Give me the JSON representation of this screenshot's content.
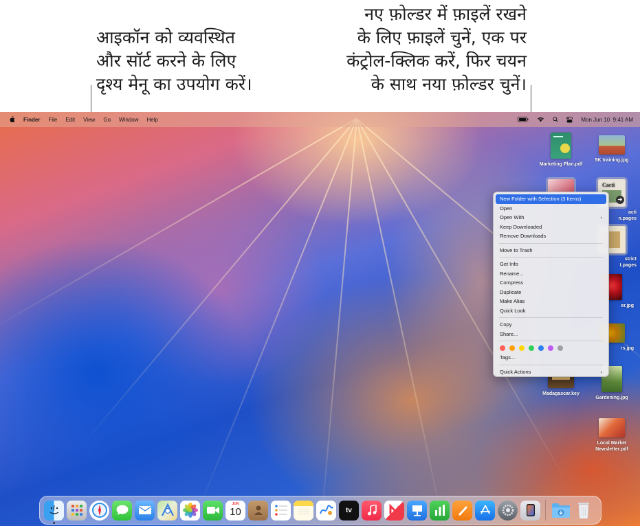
{
  "callouts": {
    "left": [
      "आइकॉन को व्यवस्थित",
      "और सॉर्ट करने के लिए",
      "दृश्य मेनू का उपयोग करें।"
    ],
    "right": [
      "नए फ़ोल्डर में फ़ाइलें रखने",
      "के लिए फ़ाइलें चुनें, एक पर",
      "कंट्रोल-क्लिक करें, फिर चयन",
      "के साथ नया फ़ोल्डर चुनें।"
    ]
  },
  "menubar": {
    "app_name": "Finder",
    "items": [
      "File",
      "Edit",
      "View",
      "Go",
      "Window",
      "Help"
    ],
    "datetime": "Mon Jun 10  9:41 AM"
  },
  "desktop_icons": [
    {
      "label": "Marketing Plan.pdf",
      "icon": "pdf-document"
    },
    {
      "label": "5K training.jpg",
      "icon": "photo-runners"
    },
    {
      "label": "acti",
      "label2": "n.pages",
      "icon": "pages-document-cacti"
    },
    {
      "label": "strict",
      "label2": "t.pages",
      "icon": "pages-document"
    },
    {
      "label": "er.jpg",
      "icon": "photo-flower"
    },
    {
      "label": "rs.jpg",
      "icon": "photo-sunflowers"
    },
    {
      "label": "Madagascar.key",
      "icon": "keynote-document"
    },
    {
      "label": "Gardening.jpg",
      "icon": "photo-garden"
    },
    {
      "label": "Local Market",
      "label2": "Newsletter.pdf",
      "icon": "pdf-newsletter"
    }
  ],
  "context_menu": {
    "group1": [
      "New Folder with Selection (3 Items)",
      "Open",
      "Open With",
      "Keep Downloaded",
      "Remove Downloads"
    ],
    "group2": [
      "Move to Trash"
    ],
    "group3": [
      "Get Info",
      "Rename...",
      "Compress",
      "Duplicate",
      "Make Alias",
      "Quick Look"
    ],
    "group4": [
      "Copy",
      "Share..."
    ],
    "tag_colors": [
      "#ff5f57",
      "#ff9f0a",
      "#ffd60a",
      "#30d158",
      "#2f80ed",
      "#bf5af2",
      "#a0a0a5"
    ],
    "tags_label": "Tags...",
    "quick_actions": "Quick Actions"
  },
  "dock": {
    "apps": [
      "Finder",
      "Launchpad",
      "Safari",
      "Messages",
      "Mail",
      "Maps",
      "Photos",
      "FaceTime",
      "Calendar",
      "Contacts",
      "Reminders",
      "Notes",
      "Freeform",
      "TV",
      "Music",
      "News",
      "Keynote",
      "Numbers",
      "Pages",
      "App Store",
      "System Settings",
      "iPhone Mirroring",
      "Downloads",
      "Trash"
    ],
    "calendar_month": "JUN",
    "calendar_day": "10",
    "tv_label": "tv"
  },
  "colors": {
    "menu_highlight": "#2f6ee6",
    "callout_text": "#1d1d1f"
  }
}
